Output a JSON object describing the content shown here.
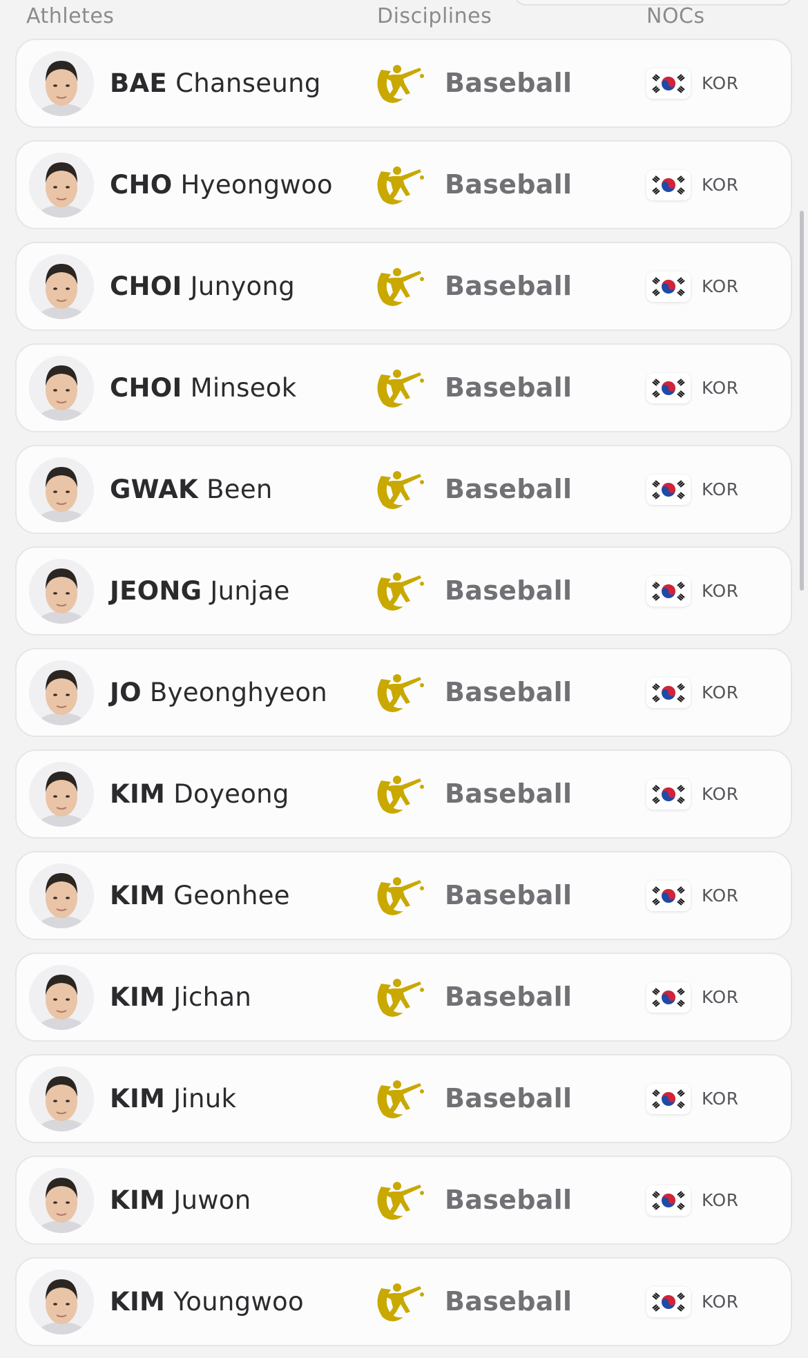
{
  "columns": {
    "athletes": "Athletes",
    "disciplines": "Disciplines",
    "nocs": "NOCs"
  },
  "discipline_icon": "baseball-pictogram-icon",
  "flag_icon": "korea-flag-icon",
  "colors": {
    "discipline_gold": "#c9a800",
    "background": "#f3f3f4",
    "card": "#fcfcfd"
  },
  "athletes": [
    {
      "surname": "BAE",
      "given": "Chanseung",
      "discipline": "Baseball",
      "noc": "KOR"
    },
    {
      "surname": "CHO",
      "given": "Hyeongwoo",
      "discipline": "Baseball",
      "noc": "KOR"
    },
    {
      "surname": "CHOI",
      "given": "Junyong",
      "discipline": "Baseball",
      "noc": "KOR"
    },
    {
      "surname": "CHOI",
      "given": "Minseok",
      "discipline": "Baseball",
      "noc": "KOR"
    },
    {
      "surname": "GWAK",
      "given": "Been",
      "discipline": "Baseball",
      "noc": "KOR"
    },
    {
      "surname": "JEONG",
      "given": "Junjae",
      "discipline": "Baseball",
      "noc": "KOR"
    },
    {
      "surname": "JO",
      "given": "Byeonghyeon",
      "discipline": "Baseball",
      "noc": "KOR"
    },
    {
      "surname": "KIM",
      "given": "Doyeong",
      "discipline": "Baseball",
      "noc": "KOR"
    },
    {
      "surname": "KIM",
      "given": "Geonhee",
      "discipline": "Baseball",
      "noc": "KOR"
    },
    {
      "surname": "KIM",
      "given": "Jichan",
      "discipline": "Baseball",
      "noc": "KOR"
    },
    {
      "surname": "KIM",
      "given": "Jinuk",
      "discipline": "Baseball",
      "noc": "KOR"
    },
    {
      "surname": "KIM",
      "given": "Juwon",
      "discipline": "Baseball",
      "noc": "KOR"
    },
    {
      "surname": "KIM",
      "given": "Youngwoo",
      "discipline": "Baseball",
      "noc": "KOR"
    }
  ]
}
